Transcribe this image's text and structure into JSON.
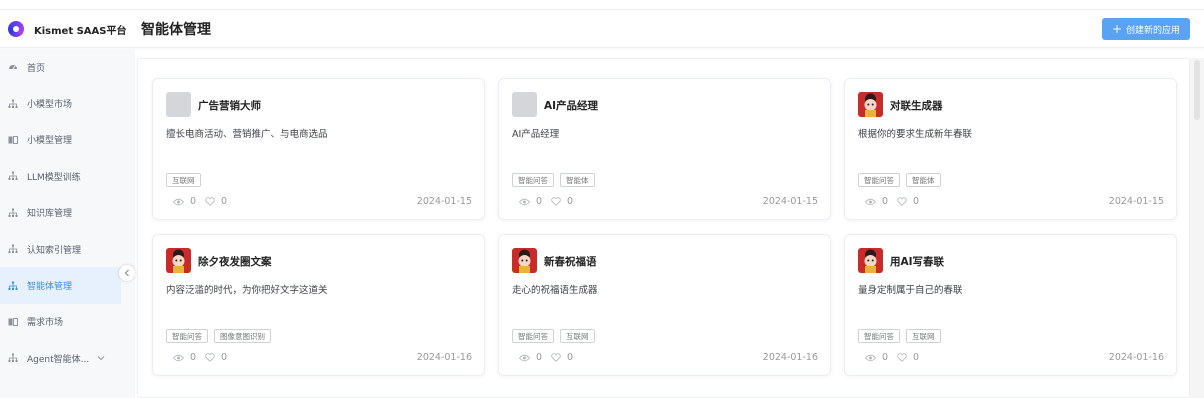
{
  "brand": {
    "name": "Kismet SAAS平台"
  },
  "header": {
    "title": "智能体管理",
    "create_label": "创建新的应用"
  },
  "sidebar": {
    "items": [
      {
        "label": "首页",
        "icon": "dashboard-icon"
      },
      {
        "label": "小模型市场",
        "icon": "tree-icon"
      },
      {
        "label": "小模型管理",
        "icon": "book-icon"
      },
      {
        "label": "LLM模型训练",
        "icon": "tree-icon"
      },
      {
        "label": "知识库管理",
        "icon": "tree-icon"
      },
      {
        "label": "认知索引管理",
        "icon": "tree-icon"
      },
      {
        "label": "智能体管理",
        "icon": "tree-icon",
        "active": true
      },
      {
        "label": "需求市场",
        "icon": "book-icon"
      },
      {
        "label": "Agent智能体...",
        "icon": "tree-icon"
      }
    ]
  },
  "cards": [
    {
      "name": "广告营销大师",
      "desc": "擅长电商活动、营销推广、与电商选品",
      "tags": [
        "互联网"
      ],
      "views": "0",
      "likes": "0",
      "date": "2024-01-15",
      "avatar": "gray"
    },
    {
      "name": "AI产品经理",
      "desc": "AI产品经理",
      "tags": [
        "智能问答",
        "智能体"
      ],
      "views": "0",
      "likes": "0",
      "date": "2024-01-15",
      "avatar": "gray"
    },
    {
      "name": "对联生成器",
      "desc": "根据你的要求生成新年春联",
      "tags": [
        "智能问答",
        "智能体"
      ],
      "views": "0",
      "likes": "0",
      "date": "2024-01-15",
      "avatar": "red"
    },
    {
      "name": "除夕夜发圈文案",
      "desc": "内容泛滥的时代，为你把好文字这道关",
      "tags": [
        "智能问答",
        "图像意图识别"
      ],
      "views": "0",
      "likes": "0",
      "date": "2024-01-16",
      "avatar": "red"
    },
    {
      "name": "新春祝福语",
      "desc": "走心的祝福语生成器",
      "tags": [
        "智能问答",
        "互联网"
      ],
      "views": "0",
      "likes": "0",
      "date": "2024-01-16",
      "avatar": "red"
    },
    {
      "name": "用AI写春联",
      "desc": "量身定制属于自己的春联",
      "tags": [
        "智能问答",
        "互联网"
      ],
      "views": "0",
      "likes": "0",
      "date": "2024-01-16",
      "avatar": "red"
    }
  ],
  "colors": {
    "accent": "#5aa2f3",
    "active_bg": "#e6f1fd",
    "active_text": "#3a8ee6",
    "avatar_red": "#c92a2a"
  }
}
